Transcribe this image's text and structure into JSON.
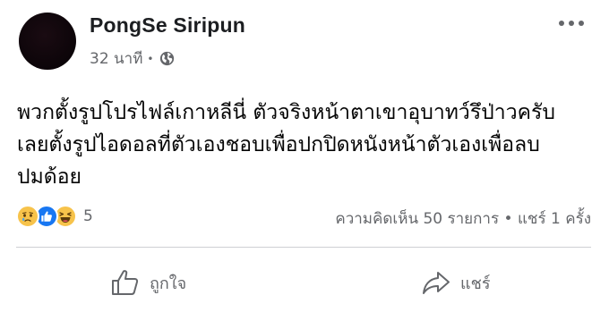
{
  "post": {
    "author": "PongSe Siripun",
    "time": "32 นาที",
    "separator": "•",
    "privacy_icon": "globe-icon",
    "body_lines": [
      "พวกตั้งรูปโปรไฟล์เกาหลีนี่ ตัวจริงหน้าตาเขาอุบาทว์รึป่าวครับ",
      "เลยตั้งรูปไอดอลที่ตัวเองชอบเพื่อปกปิดหนังหน้าตัวเองเพื่อลบ",
      "ปมด้อย"
    ],
    "reactions": {
      "icons": [
        "sad-reaction-icon",
        "like-reaction-icon",
        "haha-reaction-icon"
      ],
      "count": "5"
    },
    "stats": "ความคิดเห็น 50 รายการ • แชร์ 1 ครั้ง",
    "actions": {
      "like_label": "ถูกใจ",
      "share_label": "แชร์"
    }
  },
  "colors": {
    "secondary_text": "#65676b",
    "like_blue": "#1877f2",
    "emoji_yellow": "#f7c34b",
    "divider": "#ced0d4"
  }
}
